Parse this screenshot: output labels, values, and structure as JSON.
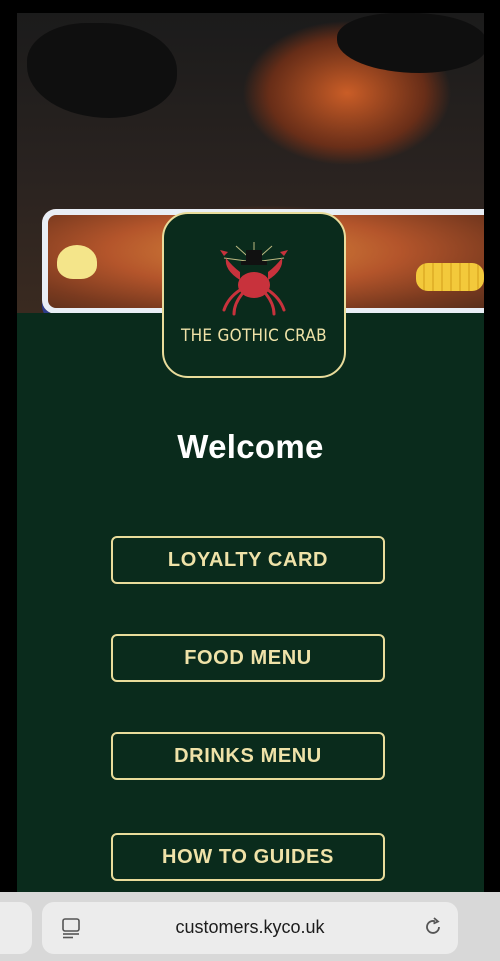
{
  "brand": {
    "name": "THE GOTHIC CRAB",
    "colors": {
      "background": "#0a2b1c",
      "accent": "#e9dc9b",
      "crab": "#c8323c"
    }
  },
  "main": {
    "welcome": "Welcome",
    "buttons": [
      {
        "label": "LOYALTY CARD"
      },
      {
        "label": "FOOD MENU"
      },
      {
        "label": "DRINKS MENU"
      },
      {
        "label": "HOW TO GUIDES"
      }
    ]
  },
  "browser": {
    "url": "customers.kyco.uk",
    "icons": [
      "page-settings-icon",
      "reload-icon"
    ]
  }
}
